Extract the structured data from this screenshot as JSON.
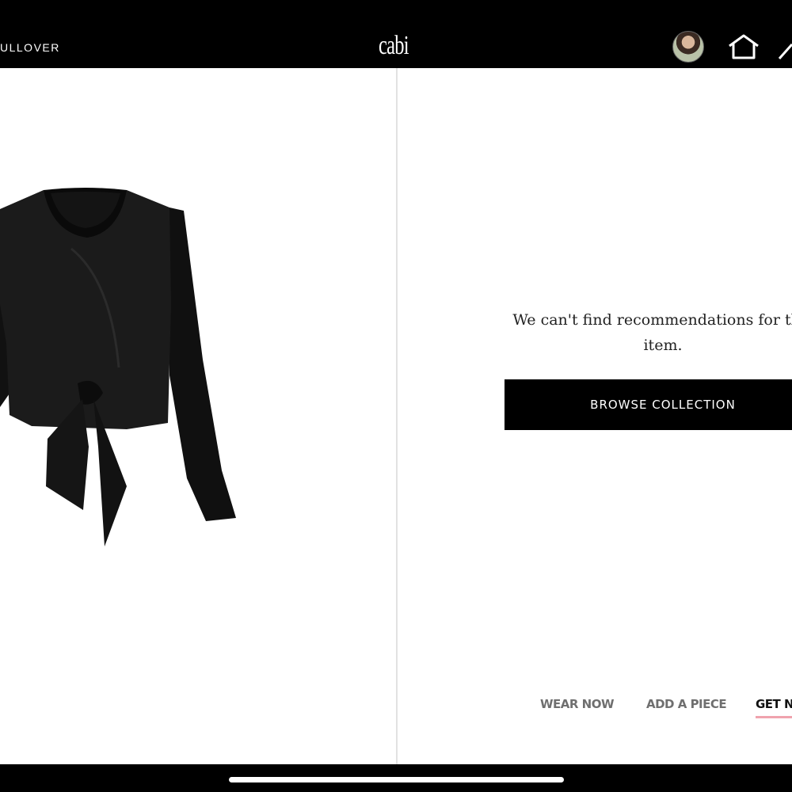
{
  "header": {
    "title": "ULLOVER",
    "logo": "cabi",
    "icons": [
      "avatar",
      "home-icon",
      "edge-icon"
    ]
  },
  "product": {
    "image": "black-long-sleeve-tie-front-top"
  },
  "recommendations": {
    "message": "We can't find recommendations for this item.",
    "button_label": "BROWSE COLLECTION"
  },
  "tabs": [
    {
      "label": "WEAR NOW",
      "active": false
    },
    {
      "label": "ADD A PIECE",
      "active": false
    },
    {
      "label": "GET N",
      "active": true
    }
  ],
  "colors": {
    "background": "#000000",
    "content": "#ffffff",
    "accent_underline": "#f0a3ae"
  }
}
